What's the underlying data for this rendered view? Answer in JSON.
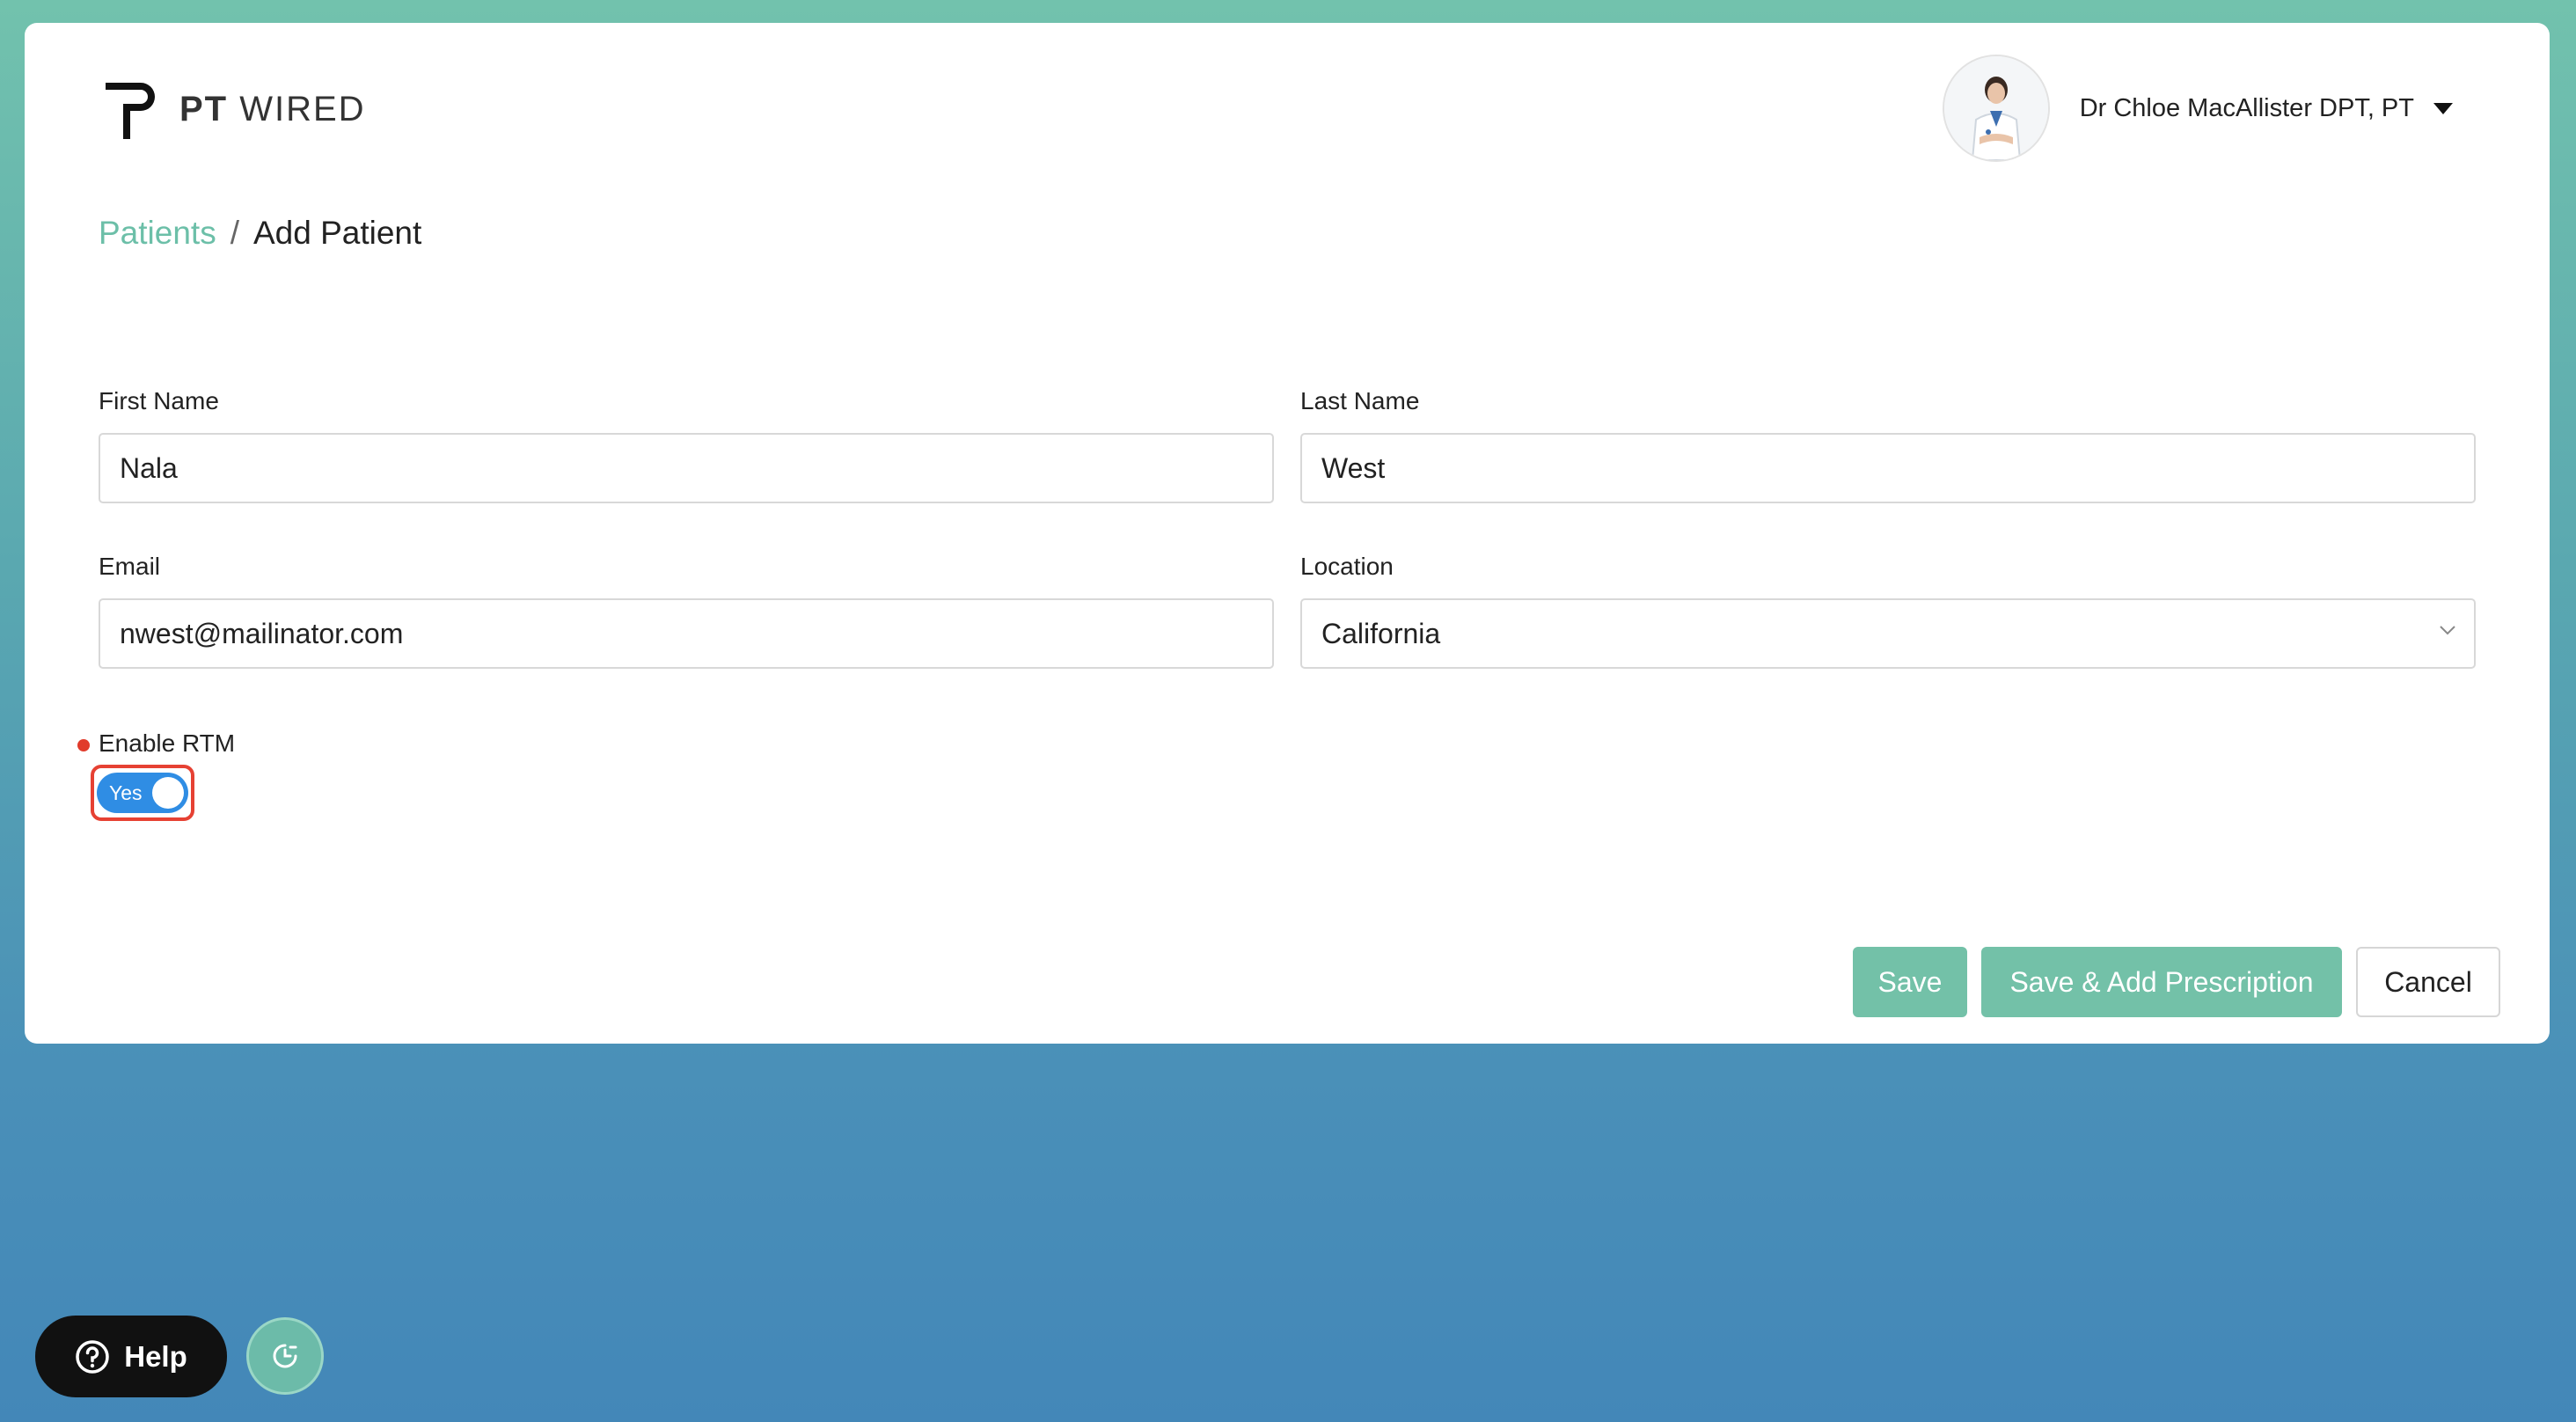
{
  "brand": {
    "bold": "PT",
    "light": "WIRED"
  },
  "user": {
    "name": "Dr Chloe MacAllister DPT, PT"
  },
  "breadcrumb": {
    "parent": "Patients",
    "separator": "/",
    "current": "Add Patient"
  },
  "form": {
    "first_name": {
      "label": "First Name",
      "value": "Nala"
    },
    "last_name": {
      "label": "Last Name",
      "value": "West"
    },
    "email": {
      "label": "Email",
      "value": "nwest@mailinator.com"
    },
    "location": {
      "label": "Location",
      "value": "California"
    },
    "rtm": {
      "label": "Enable RTM",
      "toggle_text": "Yes",
      "enabled": true
    }
  },
  "actions": {
    "save": "Save",
    "save_prescription": "Save & Add Prescription",
    "cancel": "Cancel"
  },
  "help": {
    "label": "Help"
  },
  "colors": {
    "accent": "#73c1a8",
    "toggle": "#2f8de4",
    "highlight": "#e64133"
  }
}
